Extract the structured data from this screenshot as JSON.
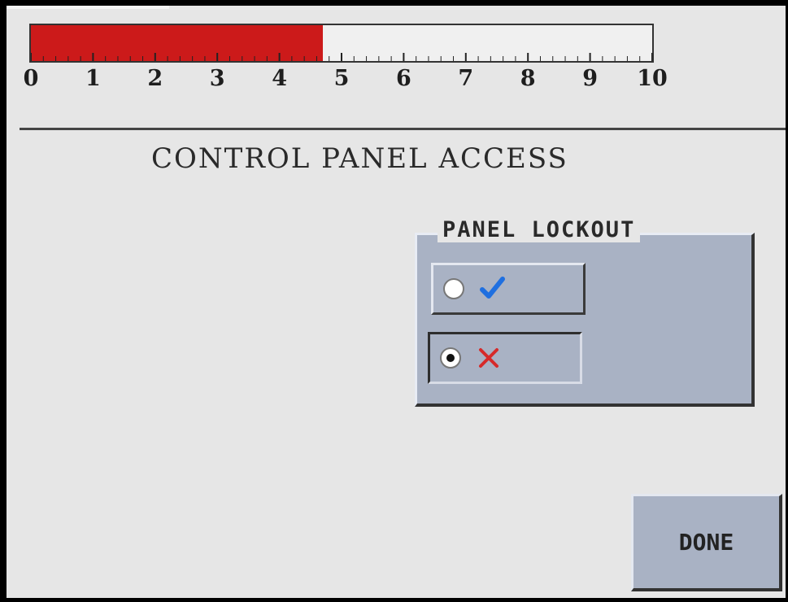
{
  "progress": {
    "value": 4.7,
    "min": 0,
    "max": 10,
    "fill_color": "#cc1a1a",
    "labels": [
      "0",
      "1",
      "2",
      "3",
      "4",
      "5",
      "6",
      "7",
      "8",
      "9",
      "10"
    ]
  },
  "page": {
    "title": "CONTROL PANEL ACCESS"
  },
  "panel_lockout": {
    "title": "PANEL LOCKOUT",
    "options": [
      {
        "icon": "checkmark-icon",
        "color": "#1f6fe0",
        "selected": false
      },
      {
        "icon": "x-mark-icon",
        "color": "#d62a2a",
        "selected": true
      }
    ]
  },
  "actions": {
    "done_label": "DONE"
  }
}
